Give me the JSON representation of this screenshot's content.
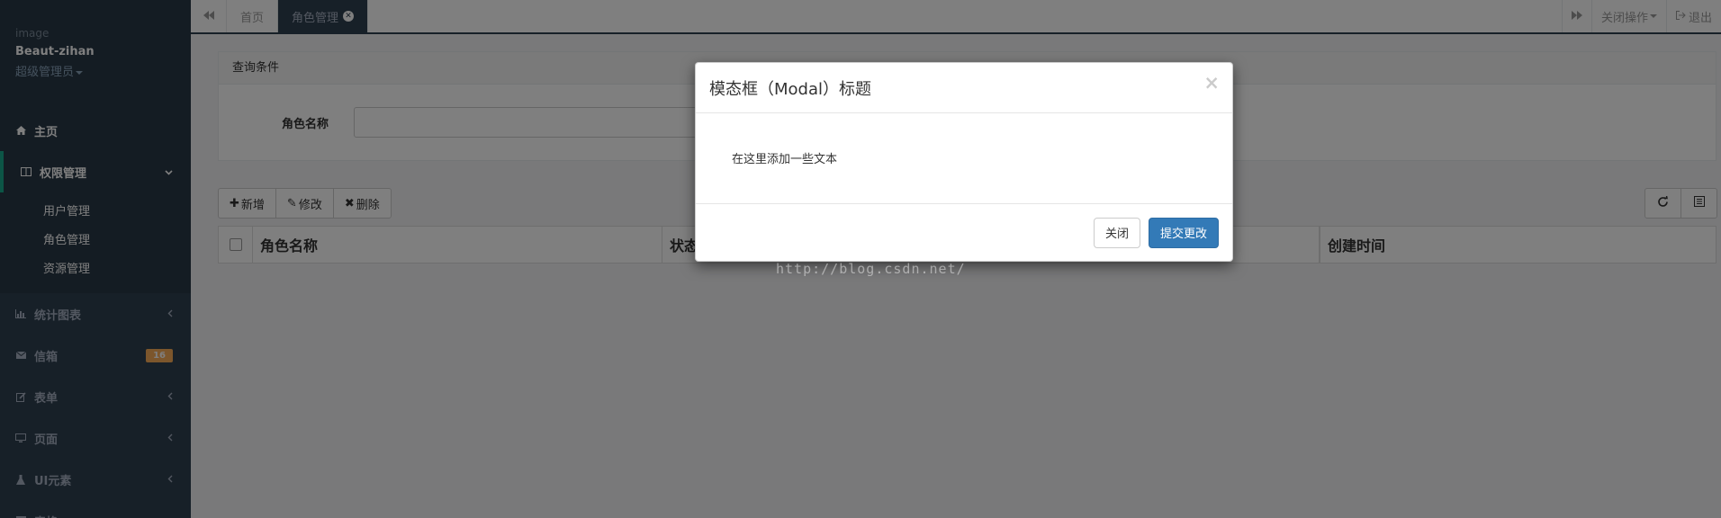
{
  "sidebar": {
    "profile": {
      "image_alt": "image",
      "username": "Beaut-zihan",
      "role": "超级管理员"
    },
    "items": [
      {
        "label": "主页",
        "icon": "home-icon"
      },
      {
        "label": "权限管理",
        "icon": "columns-icon",
        "arrow": "⌄",
        "children": [
          "用户管理",
          "角色管理",
          "资源管理"
        ]
      },
      {
        "label": "统计图表",
        "icon": "bar-chart-icon",
        "arrow": "‹"
      },
      {
        "label": "信箱",
        "icon": "envelope-icon",
        "badge": "16"
      },
      {
        "label": "表单",
        "icon": "edit-icon",
        "arrow": "‹"
      },
      {
        "label": "页面",
        "icon": "desktop-icon",
        "arrow": "‹"
      },
      {
        "label": "UI元素",
        "icon": "flask-icon",
        "arrow": "‹"
      },
      {
        "label": "表格",
        "icon": "table-icon"
      }
    ]
  },
  "topbar": {
    "tabs": [
      {
        "label": "首页",
        "active": false
      },
      {
        "label": "角色管理",
        "active": true
      }
    ],
    "close_ops": "关闭操作",
    "logout": "退出"
  },
  "query": {
    "title": "查询条件",
    "field_label": "角色名称",
    "field_value": ""
  },
  "toolbar": {
    "add": "新增",
    "edit": "修改",
    "delete": "删除"
  },
  "table": {
    "columns": [
      "角色名称",
      "状态",
      "",
      "创建时间"
    ]
  },
  "modal": {
    "title": "模态框（Modal）标题",
    "close_glyph": "×",
    "body": "在这里添加一些文本",
    "close_label": "关闭",
    "submit_label": "提交更改"
  },
  "watermark": "http://blog.csdn.net/",
  "colors": {
    "sidebar": "#2f4050",
    "sidebar_dark": "#293846",
    "accent": "#19aa8d",
    "badge": "#f8ac59",
    "primary": "#337ab7"
  }
}
